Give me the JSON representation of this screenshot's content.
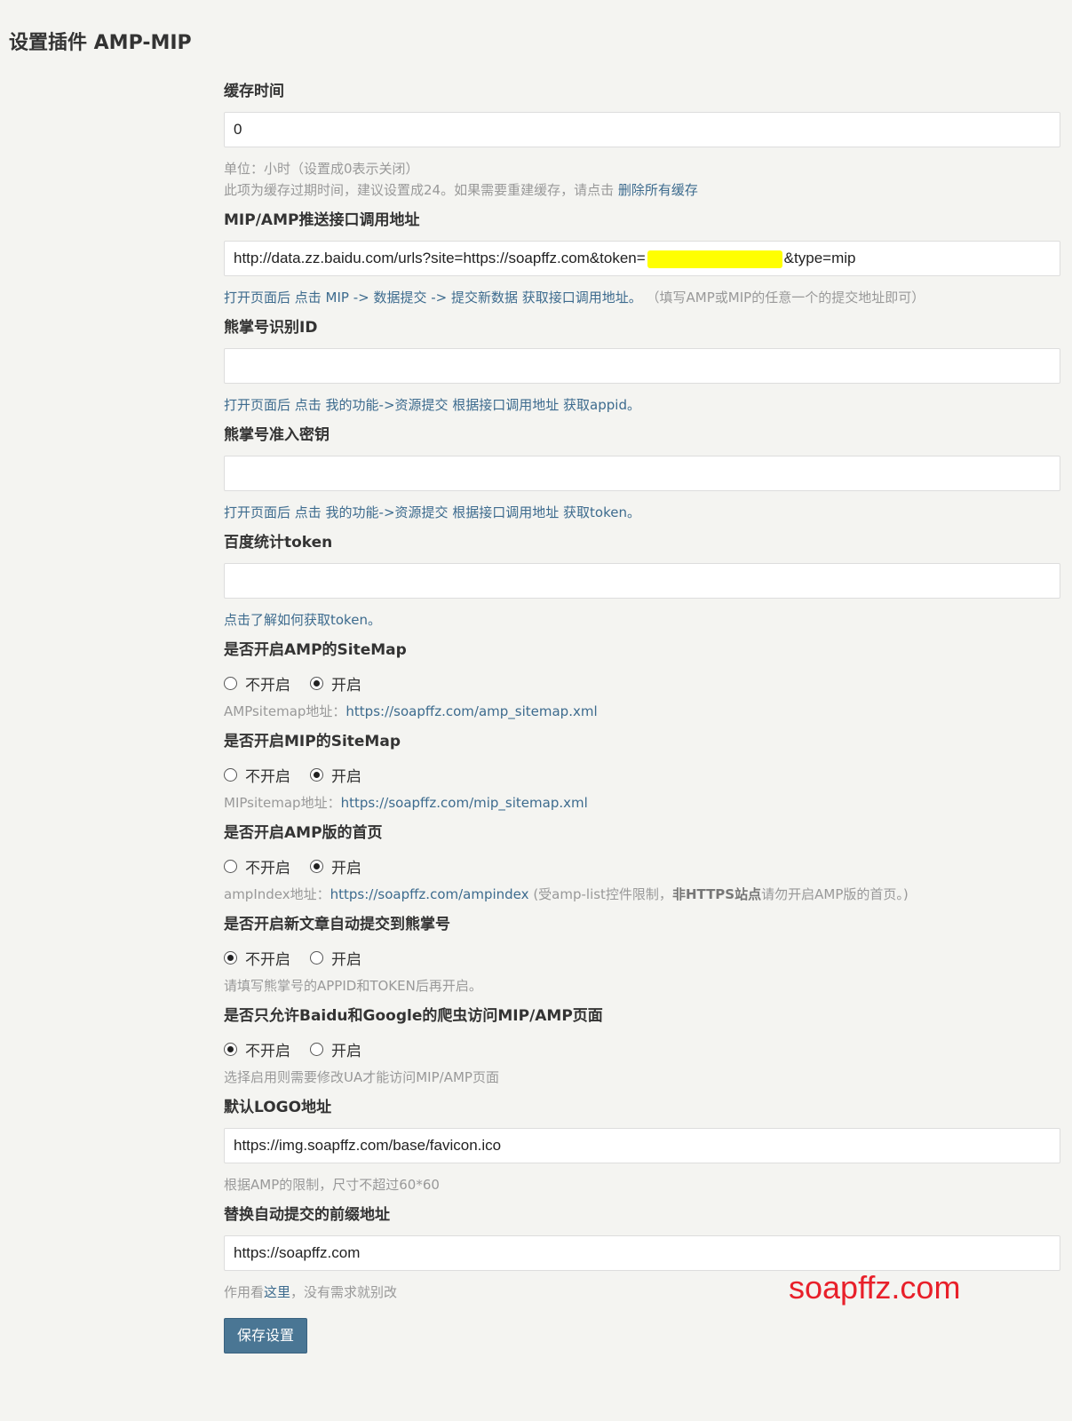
{
  "page": {
    "title": "设置插件 AMP-MIP"
  },
  "cache": {
    "label": "缓存时间",
    "value": "0",
    "hint1": "单位：小时（设置成0表示关闭）",
    "hint2": "此项为缓存过期时间，建议设置成24。如果需要重建缓存，请点击",
    "clear_link": "删除所有缓存"
  },
  "push_api": {
    "label": "MIP/AMP推送接口调用地址",
    "value_prefix": "http://data.zz.baidu.com/urls?site=https://soapffz.com&token=",
    "value_suffix": "&type=mip",
    "hint": "打开页面后 点击 MIP -> 数据提交 -> 提交新数据 获取接口调用地址。",
    "hint_note": "（填写AMP或MIP的任意一个的提交地址即可）"
  },
  "xzh_id": {
    "label": "熊掌号识别ID",
    "value": "",
    "hint": "打开页面后 点击 我的功能->资源提交 根据接口调用地址 获取appid。"
  },
  "xzh_token": {
    "label": "熊掌号准入密钥",
    "value": "",
    "hint": "打开页面后 点击 我的功能->资源提交 根据接口调用地址 获取token。"
  },
  "baidu_token": {
    "label": "百度统计token",
    "value": "",
    "hint": "点击了解如何获取token。"
  },
  "amp_sitemap": {
    "label": "是否开启AMP的SiteMap",
    "off": "不开启",
    "on": "开启",
    "selected": "on",
    "hint_prefix": "AMPsitemap地址：",
    "url": "https://soapffz.com/amp_sitemap.xml"
  },
  "mip_sitemap": {
    "label": "是否开启MIP的SiteMap",
    "off": "不开启",
    "on": "开启",
    "selected": "on",
    "hint_prefix": "MIPsitemap地址：",
    "url": "https://soapffz.com/mip_sitemap.xml"
  },
  "amp_index": {
    "label": "是否开启AMP版的首页",
    "off": "不开启",
    "on": "开启",
    "selected": "on",
    "hint_prefix": "ampIndex地址：",
    "url": "https://soapffz.com/ampindex",
    "note1": "(受amp-list控件限制，",
    "note_bold": "非HTTPS站点",
    "note2": "请勿开启AMP版的首页。)"
  },
  "auto_submit": {
    "label": "是否开启新文章自动提交到熊掌号",
    "off": "不开启",
    "on": "开启",
    "selected": "off",
    "hint": "请填写熊掌号的APPID和TOKEN后再开启。"
  },
  "crawler_only": {
    "label": "是否只允许Baidu和Google的爬虫访问MIP/AMP页面",
    "off": "不开启",
    "on": "开启",
    "selected": "off",
    "hint": "选择启用则需要修改UA才能访问MIP/AMP页面"
  },
  "logo": {
    "label": "默认LOGO地址",
    "value": "https://img.soapffz.com/base/favicon.ico",
    "hint": "根据AMP的限制，尺寸不超过60*60"
  },
  "prefix": {
    "label": "替换自动提交的前缀地址",
    "value": "https://soapffz.com",
    "hint_prefix": "作用看",
    "hint_link": "这里",
    "hint_suffix": "，没有需求就别改"
  },
  "watermark": "soapffz.com",
  "save_button": "保存设置",
  "colors": {
    "background": "#f4f4f1",
    "link": "#3d6b8e",
    "button": "#4a7694",
    "watermark": "#e8202a",
    "redaction": "#ffff00"
  }
}
